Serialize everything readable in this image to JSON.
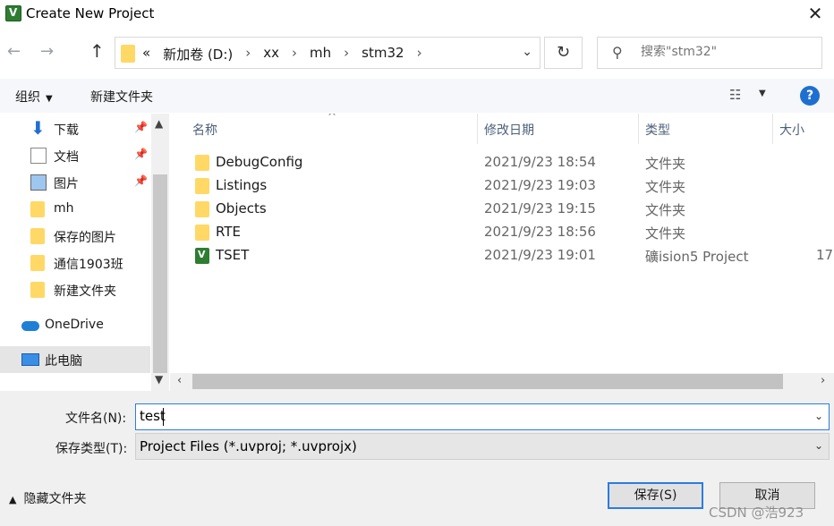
{
  "window": {
    "title": "Create New Project",
    "app_icon": "keil-uvision-icon",
    "close_glyph": "✕"
  },
  "address": {
    "overflow": "«",
    "crumbs": [
      "新加卷 (D:)",
      "xx",
      "mh",
      "stm32"
    ]
  },
  "search": {
    "placeholder": "搜索\"stm32\""
  },
  "toolbar": {
    "organize": "组织",
    "new_folder": "新建文件夹",
    "help": "?"
  },
  "sidebar": {
    "items": [
      {
        "label": "下载",
        "icon": "download-icon",
        "pinned": true
      },
      {
        "label": "文档",
        "icon": "document-icon",
        "pinned": true
      },
      {
        "label": "图片",
        "icon": "pictures-icon",
        "pinned": true
      },
      {
        "label": "mh",
        "icon": "folder-icon",
        "pinned": false
      },
      {
        "label": "保存的图片",
        "icon": "folder-icon",
        "pinned": false
      },
      {
        "label": "通信1903班",
        "icon": "folder-icon",
        "pinned": false
      },
      {
        "label": "新建文件夹",
        "icon": "folder-icon",
        "pinned": false
      },
      {
        "label": "OneDrive",
        "icon": "onedrive-cloud-icon",
        "pinned": false
      },
      {
        "label": "此电脑",
        "icon": "this-pc-icon",
        "pinned": false,
        "selected": true
      }
    ]
  },
  "columns": {
    "name": "名称",
    "date": "修改日期",
    "type": "类型",
    "size": "大小"
  },
  "files": [
    {
      "name": "DebugConfig",
      "date": "2021/9/23 18:54",
      "type": "文件夹",
      "size": "",
      "icon": "folder-icon"
    },
    {
      "name": "Listings",
      "date": "2021/9/23 19:03",
      "type": "文件夹",
      "size": "",
      "icon": "folder-icon"
    },
    {
      "name": "Objects",
      "date": "2021/9/23 19:15",
      "type": "文件夹",
      "size": "",
      "icon": "folder-icon"
    },
    {
      "name": "RTE",
      "date": "2021/9/23 18:56",
      "type": "文件夹",
      "size": "",
      "icon": "folder-icon"
    },
    {
      "name": "TSET",
      "date": "2021/9/23 19:01",
      "type": "礦ision5 Project",
      "size": "17",
      "icon": "uvision-project-icon"
    }
  ],
  "form": {
    "filename_label": "文件名(N):",
    "filename_value": "test",
    "filetype_label": "保存类型(T):",
    "filetype_value": "Project Files (*.uvproj; *.uvprojx)"
  },
  "footer": {
    "hide_folders": "隐藏文件夹",
    "save": "保存(S)",
    "cancel": "取消",
    "watermark": "CSDN @浩923"
  },
  "colors": {
    "accent": "#2d7be0",
    "folder": "#ffd866",
    "header_text": "#4c607a",
    "selected_bg": "#e5e5e5"
  }
}
